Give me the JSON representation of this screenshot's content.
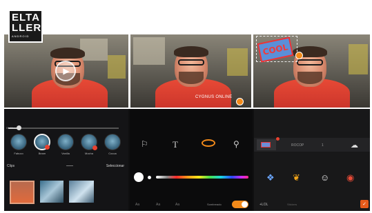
{
  "logo": {
    "line1": "ELTA",
    "line2": "LLER",
    "sub": "ANDROID"
  },
  "preview": {
    "sticker_caption": "CYGNUS ONLINE",
    "cool_sticker_text": "COOL"
  },
  "filters": {
    "time": "00:01",
    "items": [
      {
        "label": "Fabuco"
      },
      {
        "label": "Beam"
      },
      {
        "label": "Vanilla"
      },
      {
        "label": "Mocha"
      },
      {
        "label": "Cocoa"
      }
    ]
  },
  "clips": {
    "label": "Clips",
    "select_label": "Seleccionar"
  },
  "text_tools": {
    "bottom_a": "Aa",
    "bottom_b": "Aa",
    "bottom_c": "Aa",
    "toggle_label": "Sombreado",
    "toggle_on": true
  },
  "stickers": {
    "tab2": "ROCOP",
    "tab3": "1",
    "bottom_label_1": "+LOL",
    "bottom_label_2": "Stickers"
  },
  "colors": {
    "accent": "#f28a1a",
    "badge": "#e8412f"
  }
}
